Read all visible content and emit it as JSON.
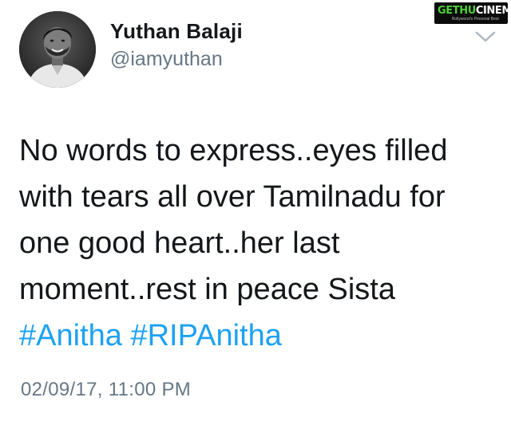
{
  "author": {
    "display_name": "Yuthan Balaji",
    "handle": "@iamyuthan"
  },
  "tweet": {
    "lines": [
      "No words to express..eyes filled",
      "with tears all over Tamilnadu for",
      "one good heart..her last",
      "moment..rest in peace Sista"
    ],
    "hashtags": [
      "#Anitha",
      "#RIPAnitha"
    ],
    "timestamp": "02/09/17, 11:00 PM"
  },
  "watermark": {
    "text_main": "GETHU",
    "text_accent": "CINEMA",
    "tagline": "Bollywood's Personal Best"
  },
  "icons": {
    "menu": "chevron-down-icon",
    "avatar": "profile-photo"
  },
  "colors": {
    "hashtag": "#1da1f2",
    "secondary_text": "#657786",
    "primary_text": "#14171a",
    "watermark_green": "#4cd137"
  }
}
